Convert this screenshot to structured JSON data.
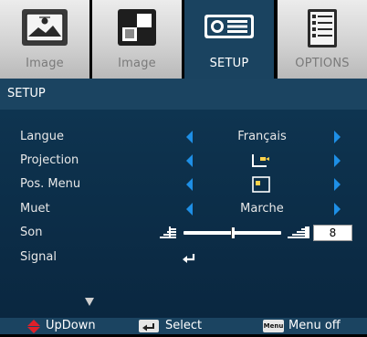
{
  "tabs": [
    {
      "label": "Image",
      "icon": "image-icon"
    },
    {
      "label": "Image",
      "icon": "advanced-image-icon"
    },
    {
      "label": "SETUP",
      "icon": "projector-setup-icon"
    },
    {
      "label": "OPTIONS",
      "icon": "options-list-icon"
    }
  ],
  "active_tab": "SETUP",
  "header": {
    "title": "SETUP"
  },
  "rows": {
    "langue": {
      "label": "Langue",
      "value": "Français"
    },
    "projection": {
      "label": "Projection",
      "icon": "projection-mode-icon"
    },
    "pos_menu": {
      "label": "Pos. Menu",
      "icon": "menu-position-icon"
    },
    "muet": {
      "label": "Muet",
      "value": "Marche"
    },
    "son": {
      "label": "Son",
      "value": "8",
      "level_fraction": 0.5
    },
    "signal": {
      "label": "Signal",
      "icon": "enter-icon"
    }
  },
  "footer": {
    "updown": "UpDown",
    "select": "Select",
    "menu_key": "Menu",
    "menu_off": "Menu off"
  },
  "colors": {
    "accent": "#1e8fe6",
    "header": "#1b4461",
    "panel": "#0e3450",
    "updown_red": "#e0202a"
  }
}
